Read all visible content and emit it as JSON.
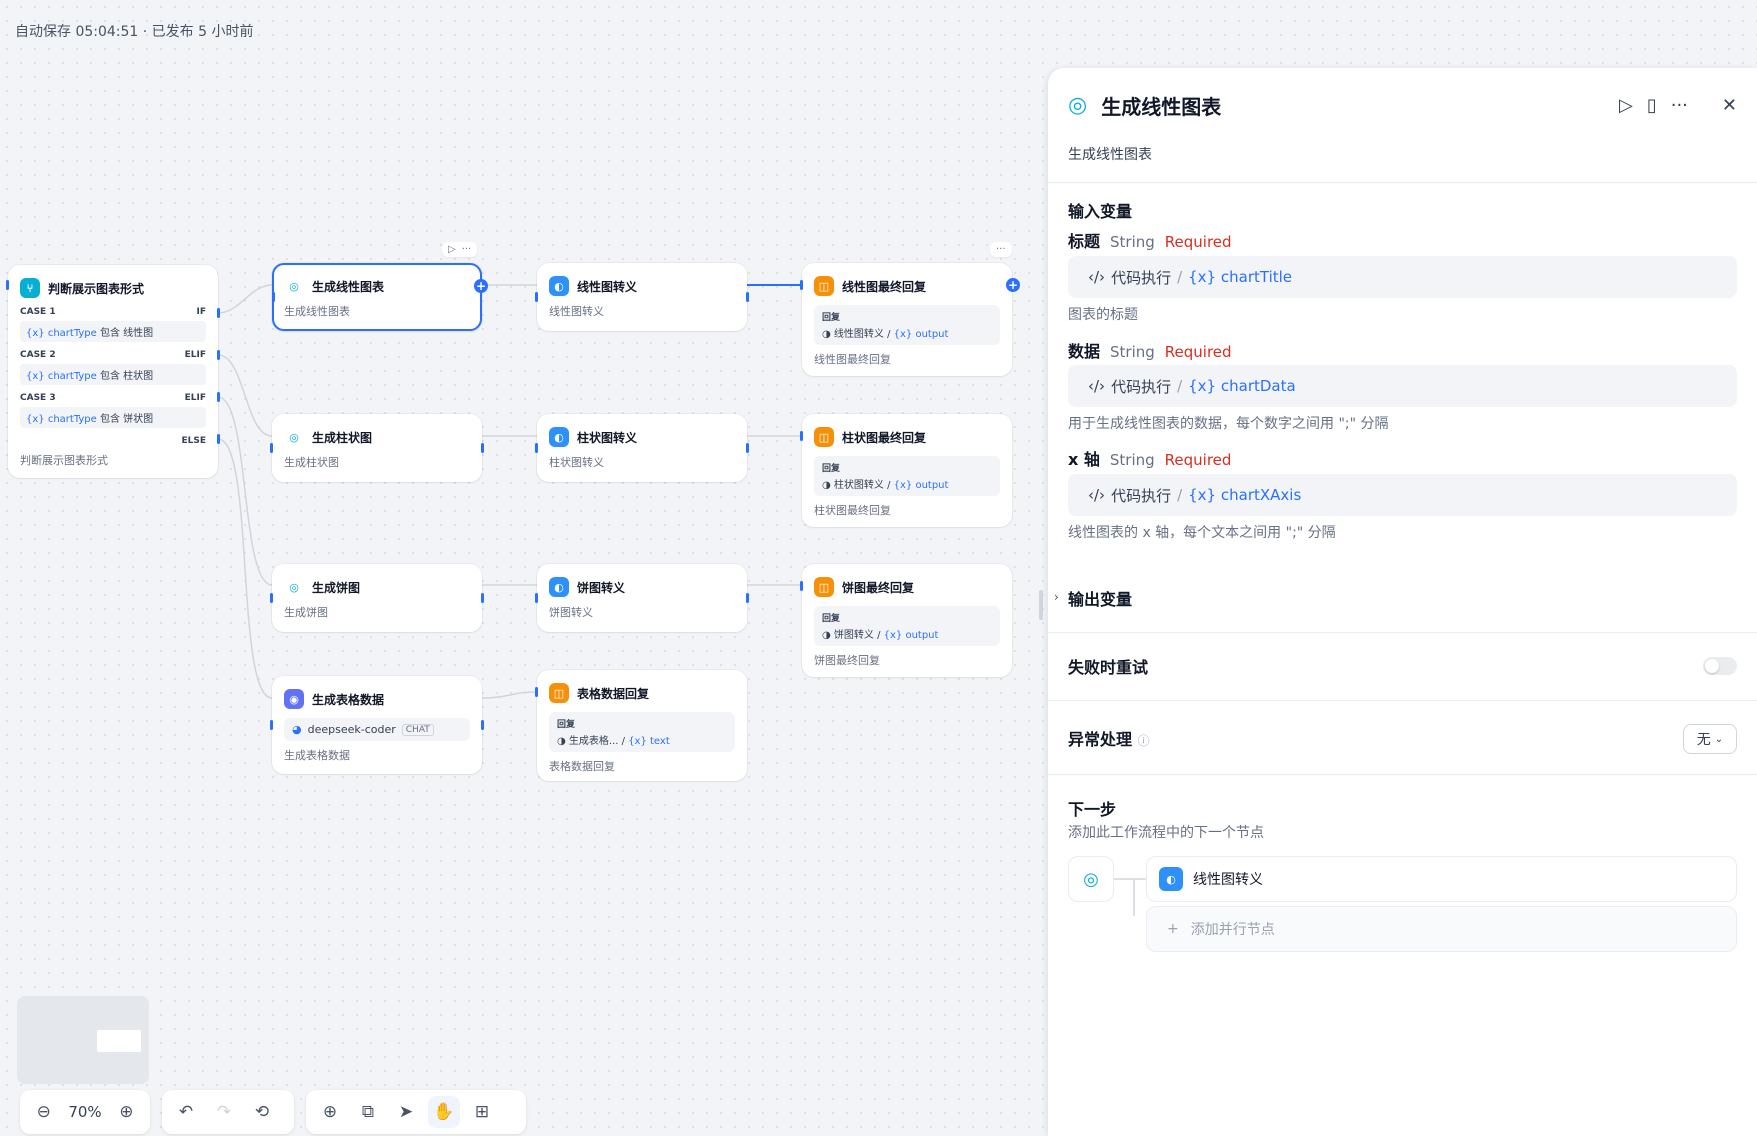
{
  "status": "自动保存 05:04:51 · 已发布 5 小时前",
  "nodes": {
    "condition": {
      "title": "判断展示图表形式",
      "desc": "判断展示图表形式",
      "cases": [
        {
          "label": "CASE 1",
          "kind": "IF",
          "var": "{x} chartType",
          "op": "包含",
          "value": "线性图"
        },
        {
          "label": "CASE 2",
          "kind": "ELIF",
          "var": "{x} chartType",
          "op": "包含",
          "value": "柱状图"
        },
        {
          "label": "CASE 3",
          "kind": "ELIF",
          "var": "{x} chartType",
          "op": "包含",
          "value": "饼状图"
        }
      ],
      "else_label": "ELSE"
    },
    "line_gen": {
      "title": "生成线性图表",
      "desc": "生成线性图表"
    },
    "line_conv": {
      "title": "线性图转义",
      "desc": "线性图转义"
    },
    "line_reply": {
      "title": "线性图最终回复",
      "reply_label": "回复",
      "src": "线性图转义",
      "var": "{x} output",
      "desc": "线性图最终回复"
    },
    "bar_gen": {
      "title": "生成柱状图",
      "desc": "生成柱状图"
    },
    "bar_conv": {
      "title": "柱状图转义",
      "desc": "柱状图转义"
    },
    "bar_reply": {
      "title": "柱状图最终回复",
      "reply_label": "回复",
      "src": "柱状图转义",
      "var": "{x} output",
      "desc": "柱状图最终回复"
    },
    "pie_gen": {
      "title": "生成饼图",
      "desc": "生成饼图"
    },
    "pie_conv": {
      "title": "饼图转义",
      "desc": "饼图转义"
    },
    "pie_reply": {
      "title": "饼图最终回复",
      "reply_label": "回复",
      "src": "饼图转义",
      "var": "{x} output",
      "desc": "饼图最终回复"
    },
    "table_gen": {
      "title": "生成表格数据",
      "model": "deepseek-coder",
      "model_tag": "CHAT",
      "desc": "生成表格数据"
    },
    "table_reply": {
      "title": "表格数据回复",
      "reply_label": "回复",
      "src": "生成表格...",
      "var": "{x} text",
      "desc": "表格数据回复"
    }
  },
  "toolbar": {
    "zoom": "70%"
  },
  "panel": {
    "title": "生成线性图表",
    "subtitle": "生成线性图表",
    "input_section": "输入变量",
    "fields": [
      {
        "name": "标题",
        "type": "String",
        "required": "Required",
        "source": "代码执行",
        "var": "{x} chartTitle",
        "desc": "图表的标题"
      },
      {
        "name": "数据",
        "type": "String",
        "required": "Required",
        "source": "代码执行",
        "var": "{x} chartData",
        "desc": "用于生成线性图表的数据，每个数字之间用 \";\" 分隔"
      },
      {
        "name": "x 轴",
        "type": "String",
        "required": "Required",
        "source": "代码执行",
        "var": "{x} chartXAxis",
        "desc": "线性图表的 x 轴，每个文本之间用 \";\" 分隔"
      }
    ],
    "output_section": "输出变量",
    "retry_label": "失败时重试",
    "error_label": "异常处理",
    "error_value": "无",
    "next_title": "下一步",
    "next_desc": "添加此工作流程中的下一个节点",
    "next_node": "线性图转义",
    "add_parallel": "添加并行节点"
  },
  "colors": {
    "accent": "#2970ff",
    "required": "#d92d20",
    "teal": "#06aed4",
    "orange": "#f79009"
  }
}
